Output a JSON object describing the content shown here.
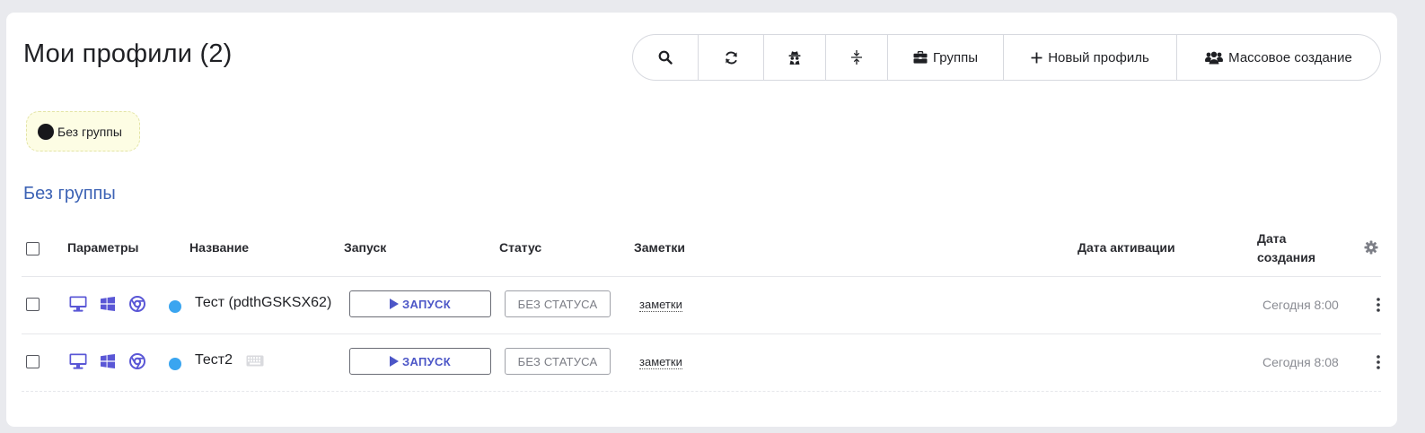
{
  "page": {
    "title": "Мои профили (2)"
  },
  "toolbar": {
    "search_icon": "search-icon",
    "refresh_icon": "refresh-icon",
    "spy_icon": "incognito-icon",
    "compress_icon": "compress-vertical-icon",
    "groups_label": "Группы",
    "new_profile_label": "Новый профиль",
    "mass_create_label": "Массовое создание"
  },
  "group_filter": {
    "label": "Без группы",
    "color": "#17171b"
  },
  "group_heading": "Без группы",
  "table": {
    "headers": {
      "params": "Параметры",
      "name": "Название",
      "launch": "Запуск",
      "status": "Статус",
      "notes": "Заметки",
      "activation_date": "Дата активации",
      "created_date_line1": "Дата",
      "created_date_line2": "создания"
    },
    "rows": [
      {
        "name": "Тест (pdthGSKSX62)",
        "launch_label": "ЗАПУСК",
        "status_label": "БЕЗ СТАТУСА",
        "notes": "заметки",
        "activation_date": "",
        "created": "Сегодня 8:00",
        "status_color": "#3aa5f0",
        "has_keyboard_icon": false
      },
      {
        "name": "Тест2",
        "launch_label": "ЗАПУСК",
        "status_label": "БЕЗ СТАТУСА",
        "notes": "заметки",
        "activation_date": "",
        "created": "Сегодня 8:08",
        "status_color": "#3aa5f0",
        "has_keyboard_icon": true
      }
    ]
  },
  "colors": {
    "accent": "#4c56c7",
    "icon_purple": "#5a57d6",
    "group_link": "#3d63b5"
  }
}
